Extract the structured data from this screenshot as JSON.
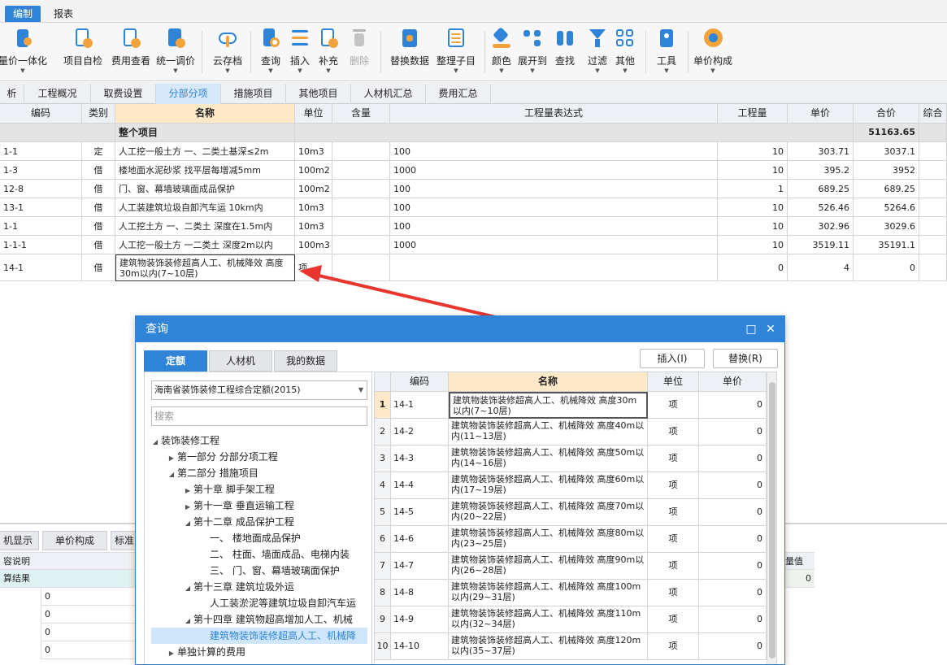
{
  "menubar": {
    "tabs": [
      "编制",
      "报表"
    ]
  },
  "ribbon": {
    "buttons": [
      "量价一体化",
      "项目自检",
      "费用查看",
      "统一调价",
      "云存档",
      "查询",
      "插入",
      "补充",
      "删除",
      "替换数据",
      "整理子目",
      "颜色",
      "展开到",
      "查找",
      "过滤",
      "其他",
      "工具",
      "单价构成"
    ]
  },
  "page_tabs": [
    "析",
    "工程概况",
    "取费设置",
    "分部分项",
    "措施项目",
    "其他项目",
    "人材机汇总",
    "费用汇总"
  ],
  "grid": {
    "headers": [
      "编码",
      "类别",
      "名称",
      "单位",
      "含量",
      "工程量表达式",
      "工程量",
      "单价",
      "合价",
      "综合"
    ],
    "summary": {
      "name": "整个项目",
      "total": "51163.65"
    },
    "rows": [
      {
        "code": "1-1",
        "type": "定",
        "name": "人工挖一般土方 一、二类土基深≤2m",
        "unit": "10m3",
        "content": "",
        "expr": "100",
        "qty": "10",
        "price": "303.71",
        "total": "3037.1"
      },
      {
        "code": "1-3",
        "type": "借",
        "name": "楼地面水泥砂浆 找平层每增减5mm",
        "unit": "100m2",
        "content": "",
        "expr": "1000",
        "qty": "10",
        "price": "395.2",
        "total": "3952"
      },
      {
        "code": "12-8",
        "type": "借",
        "name": "门、窗、幕墙玻璃面成品保护",
        "unit": "100m2",
        "content": "",
        "expr": "100",
        "qty": "1",
        "price": "689.25",
        "total": "689.25"
      },
      {
        "code": "13-1",
        "type": "借",
        "name": "人工装建筑垃圾自卸汽车运 10km内",
        "unit": "10m3",
        "content": "",
        "expr": "100",
        "qty": "10",
        "price": "526.46",
        "total": "5264.6"
      },
      {
        "code": "1-1",
        "type": "借",
        "name": "人工挖土方 一、二类土 深度在1.5m内",
        "unit": "10m3",
        "content": "",
        "expr": "100",
        "qty": "10",
        "price": "302.96",
        "total": "3029.6"
      },
      {
        "code": "1-1-1",
        "type": "借",
        "name": "人工挖一般土方 一二类土 深度2m以内",
        "unit": "100m3",
        "content": "",
        "expr": "1000",
        "qty": "10",
        "price": "3519.11",
        "total": "35191.1"
      },
      {
        "code": "14-1",
        "type": "借",
        "name": "建筑物装饰装修超高人工、机械降效 高度30m以内(7~10层)",
        "unit": "项",
        "content": "",
        "expr": "",
        "qty": "0",
        "price": "4",
        "total": "0"
      }
    ]
  },
  "bottom": {
    "tabs": [
      "机显示",
      "单价构成",
      "标准"
    ],
    "col_header": "容说明",
    "result_label": "算结果",
    "values": [
      "0",
      "0",
      "0",
      "0"
    ],
    "right_header": "量值",
    "right_value": "0"
  },
  "dialog": {
    "title": "查询",
    "tabs": [
      "定额",
      "人材机",
      "我的数据"
    ],
    "insert_label": "插入(I)",
    "replace_label": "替换(R)",
    "library": "海南省装饰装修工程综合定额(2015)",
    "search_placeholder": "搜索",
    "tree": [
      {
        "label": "装饰装修工程",
        "twisty": "◢"
      },
      {
        "label": "第一部分 分部分项工程",
        "twisty": "▶"
      },
      {
        "label": "第二部分 措施项目",
        "twisty": "◢"
      },
      {
        "label": "第十章 脚手架工程",
        "twisty": "▶"
      },
      {
        "label": "第十一章 垂直运输工程",
        "twisty": "▶"
      },
      {
        "label": "第十二章 成品保护工程",
        "twisty": "◢"
      },
      {
        "label": "一、 楼地面成品保护",
        "twisty": ""
      },
      {
        "label": "二、 柱面、墙面成品、电梯内装",
        "twisty": ""
      },
      {
        "label": "三、 门、窗、幕墙玻璃面保护",
        "twisty": ""
      },
      {
        "label": "第十三章 建筑垃圾外运",
        "twisty": "◢"
      },
      {
        "label": "人工装淤泥等建筑垃圾自卸汽车运",
        "twisty": ""
      },
      {
        "label": "第十四章 建筑物超高增加人工、机械",
        "twisty": "◢"
      },
      {
        "label": "建筑物装饰装修超高人工、机械降",
        "twisty": ""
      },
      {
        "label": "单独计算的费用",
        "twisty": "▶"
      }
    ],
    "columns": [
      "编码",
      "名称",
      "单位",
      "单价"
    ],
    "rows": [
      {
        "idx": "1",
        "code": "14-1",
        "name": "建筑物装饰装修超高人工、机械降效 高度30m以内(7~10层)",
        "unit": "项",
        "price": "0"
      },
      {
        "idx": "2",
        "code": "14-2",
        "name": "建筑物装饰装修超高人工、机械降效 高度40m以内(11~13层)",
        "unit": "项",
        "price": "0"
      },
      {
        "idx": "3",
        "code": "14-3",
        "name": "建筑物装饰装修超高人工、机械降效 高度50m以内(14~16层)",
        "unit": "项",
        "price": "0"
      },
      {
        "idx": "4",
        "code": "14-4",
        "name": "建筑物装饰装修超高人工、机械降效 高度60m以内(17~19层)",
        "unit": "项",
        "price": "0"
      },
      {
        "idx": "5",
        "code": "14-5",
        "name": "建筑物装饰装修超高人工、机械降效 高度70m以内(20~22层)",
        "unit": "项",
        "price": "0"
      },
      {
        "idx": "6",
        "code": "14-6",
        "name": "建筑物装饰装修超高人工、机械降效 高度80m以内(23~25层)",
        "unit": "项",
        "price": "0"
      },
      {
        "idx": "7",
        "code": "14-7",
        "name": "建筑物装饰装修超高人工、机械降效 高度90m以内(26~28层)",
        "unit": "项",
        "price": "0"
      },
      {
        "idx": "8",
        "code": "14-8",
        "name": "建筑物装饰装修超高人工、机械降效 高度100m以内(29~31层)",
        "unit": "项",
        "price": "0"
      },
      {
        "idx": "9",
        "code": "14-9",
        "name": "建筑物装饰装修超高人工、机械降效 高度110m以内(32~34层)",
        "unit": "项",
        "price": "0"
      },
      {
        "idx": "10",
        "code": "14-10",
        "name": "建筑物装饰装修超高人工、机械降效 高度120m以内(35~37层)",
        "unit": "项",
        "price": "0"
      }
    ]
  },
  "colors": {
    "accent": "#2f84d8",
    "header_highlight": "#fde8c8",
    "arrow": "#e8362f"
  }
}
